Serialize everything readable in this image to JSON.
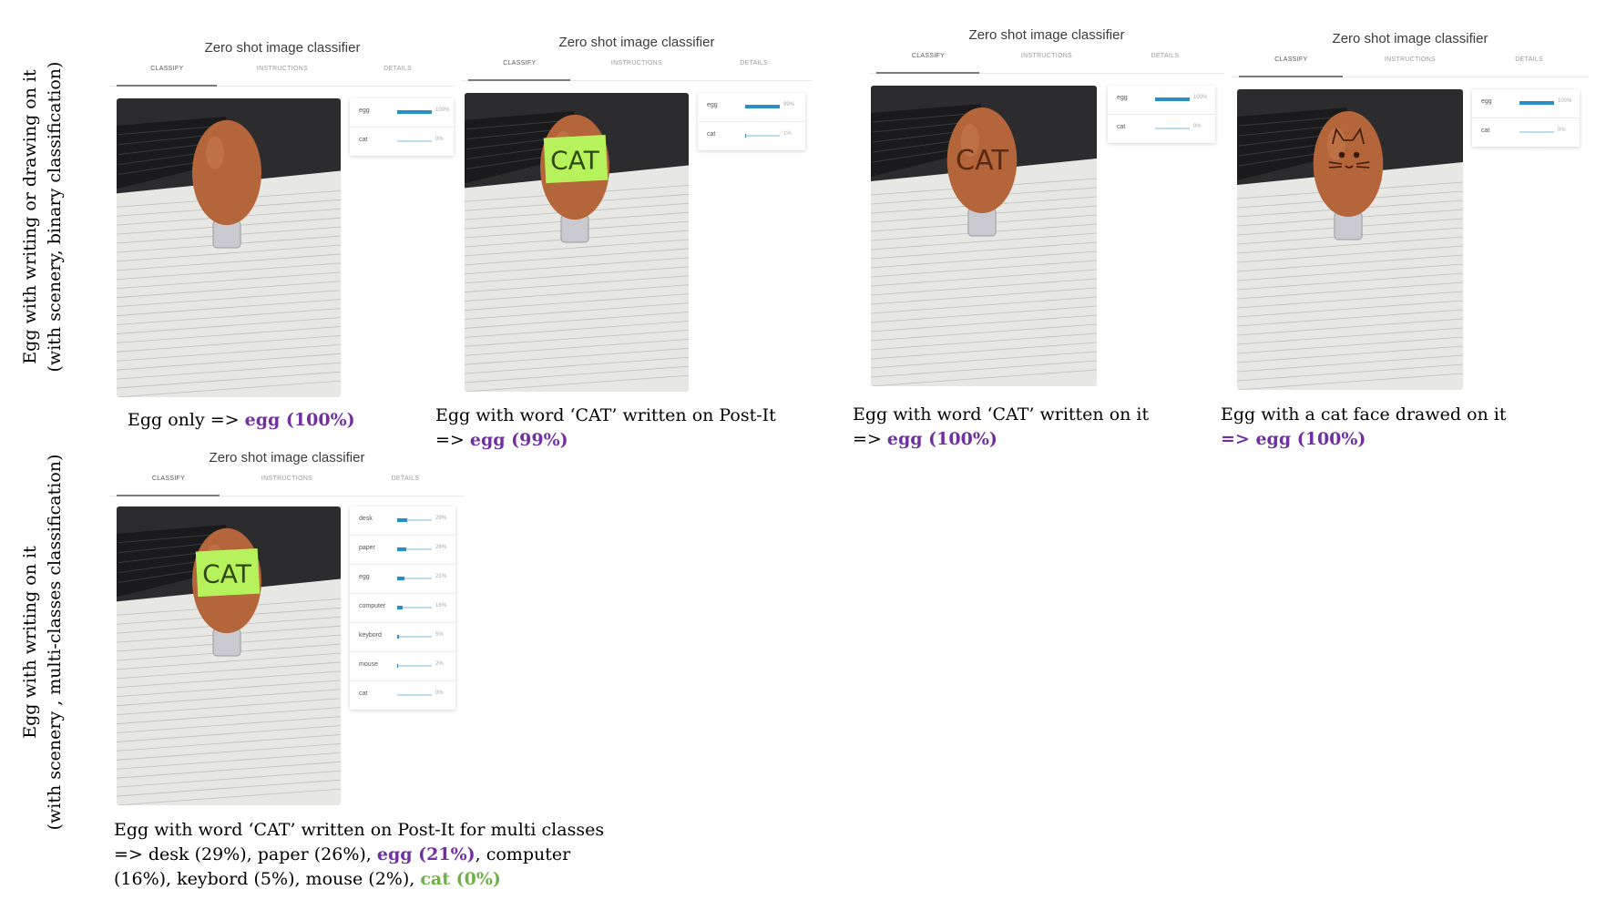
{
  "row_labels": {
    "top_line1": "Egg with writing or drawing on it",
    "top_line2": "(with scenery, binary classification)",
    "bottom_line1": "Egg with writing on it",
    "bottom_line2": "(with scenery , multi-classes classification)"
  },
  "app": {
    "title": "Zero shot image classifier",
    "tabs": [
      "CLASSIFY",
      "INSTRUCTIONS",
      "DETAILS"
    ]
  },
  "panels": [
    {
      "egg_mark": "none",
      "results": [
        {
          "label": "egg",
          "pct": "100%",
          "value": 1.0
        },
        {
          "label": "cat",
          "pct": "0%",
          "value": 0.0
        }
      ]
    },
    {
      "egg_mark": "postit",
      "postit_text": "CAT",
      "results": [
        {
          "label": "egg",
          "pct": "99%",
          "value": 0.99
        },
        {
          "label": "cat",
          "pct": "1%",
          "value": 0.01
        }
      ]
    },
    {
      "egg_mark": "written",
      "written_text": "CAT",
      "results": [
        {
          "label": "egg",
          "pct": "100%",
          "value": 1.0
        },
        {
          "label": "cat",
          "pct": "0%",
          "value": 0.0
        }
      ]
    },
    {
      "egg_mark": "catface",
      "results": [
        {
          "label": "egg",
          "pct": "100%",
          "value": 1.0
        },
        {
          "label": "cat",
          "pct": "0%",
          "value": 0.0
        }
      ]
    },
    {
      "egg_mark": "postit",
      "postit_text": "CAT",
      "results": [
        {
          "label": "desk",
          "pct": "29%",
          "value": 0.29
        },
        {
          "label": "paper",
          "pct": "26%",
          "value": 0.26
        },
        {
          "label": "egg",
          "pct": "21%",
          "value": 0.21
        },
        {
          "label": "computer",
          "pct": "16%",
          "value": 0.16
        },
        {
          "label": "keybord",
          "pct": "5%",
          "value": 0.05
        },
        {
          "label": "mouse",
          "pct": "2%",
          "value": 0.02
        },
        {
          "label": "cat",
          "pct": "0%",
          "value": 0.0
        }
      ]
    }
  ],
  "captions": {
    "c1_text": "Egg only => ",
    "c1_result": "egg (100%)",
    "c2_line1": "Egg with word ‘CAT’ written on Post-It",
    "c2_arrow": "=> ",
    "c2_result": "egg (99%)",
    "c3_line1": "Egg with word ‘CAT’ written on it",
    "c3_arrow": "=> ",
    "c3_result": "egg (100%)",
    "c4_line1": "Egg with a cat face drawed on it",
    "c4_result": "=> egg (100%)",
    "c5_line1": "Egg with word ‘CAT’ written on Post-It for multi classes",
    "c5_line2a": "=> desk (29%), paper (26%), ",
    "c5_line2b": "egg (21%)",
    "c5_line2c": ", computer",
    "c5_line3a": "(16%), keybord (5%), mouse (2%), ",
    "c5_line3b": "cat (0%)"
  },
  "colors": {
    "highlight_purple": "#7030a0",
    "highlight_green": "#70b04a",
    "bar_fill": "#2a8fc7",
    "bar_track": "#b9dcef"
  }
}
